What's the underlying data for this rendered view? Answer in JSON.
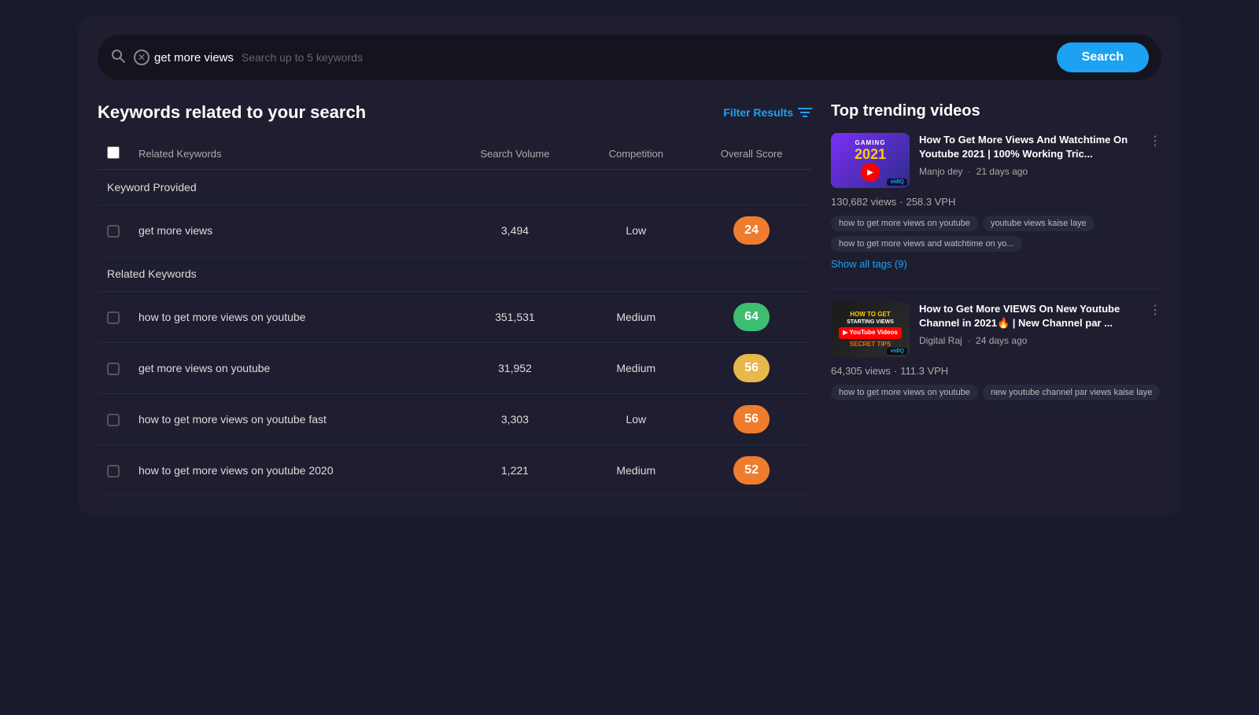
{
  "searchBar": {
    "keyword": "get more views",
    "placeholder": "Search up to 5 keywords",
    "searchButtonLabel": "Search",
    "closeIcon": "✕",
    "searchIconChar": "🔍"
  },
  "keywordsSection": {
    "title": "Keywords related to your search",
    "filterLabel": "Filter Results",
    "tableHeaders": {
      "keyword": "Related Keywords",
      "volume": "Search Volume",
      "competition": "Competition",
      "score": "Overall Score"
    },
    "providedGroupLabel": "Keyword Provided",
    "relatedGroupLabel": "Related Keywords",
    "providedKeywords": [
      {
        "keyword": "get more views",
        "volume": "3,494",
        "competition": "Low",
        "score": "24",
        "scoreClass": "score-orange"
      }
    ],
    "relatedKeywords": [
      {
        "keyword": "how to get more views on youtube",
        "volume": "351,531",
        "competition": "Medium",
        "score": "64",
        "scoreClass": "score-green"
      },
      {
        "keyword": "get more views on youtube",
        "volume": "31,952",
        "competition": "Medium",
        "score": "56",
        "scoreClass": "score-yellow"
      },
      {
        "keyword": "how to get more views on youtube fast",
        "volume": "3,303",
        "competition": "Low",
        "score": "56",
        "scoreClass": "score-orange"
      },
      {
        "keyword": "how to get more views on youtube 2020",
        "volume": "1,221",
        "competition": "Medium",
        "score": "52",
        "scoreClass": "score-orange"
      }
    ]
  },
  "trendingSection": {
    "title": "Top trending videos",
    "videos": [
      {
        "id": "v1",
        "title": "How To Get More Views And Watchtime On Youtube 2021 | 100% Working Tric...",
        "channel": "Manjo dey",
        "timeAgo": "21 days ago",
        "views": "130,682 views",
        "vph": "258.3 VPH",
        "tags": [
          "how to get more views on youtube",
          "youtube views kaise laye",
          "how to get more views and watchtime on yo..."
        ],
        "showAllTags": "Show all tags (9)"
      },
      {
        "id": "v2",
        "title": "How to Get More VIEWS On New Youtube Channel in 2021🔥 | New Channel par ...",
        "channel": "Digital Raj",
        "timeAgo": "24 days ago",
        "views": "64,305 views",
        "vph": "111.3 VPH",
        "tags": [
          "how to get more views on youtube",
          "new youtube channel par views kaise laye"
        ],
        "showAllTags": null
      }
    ]
  }
}
